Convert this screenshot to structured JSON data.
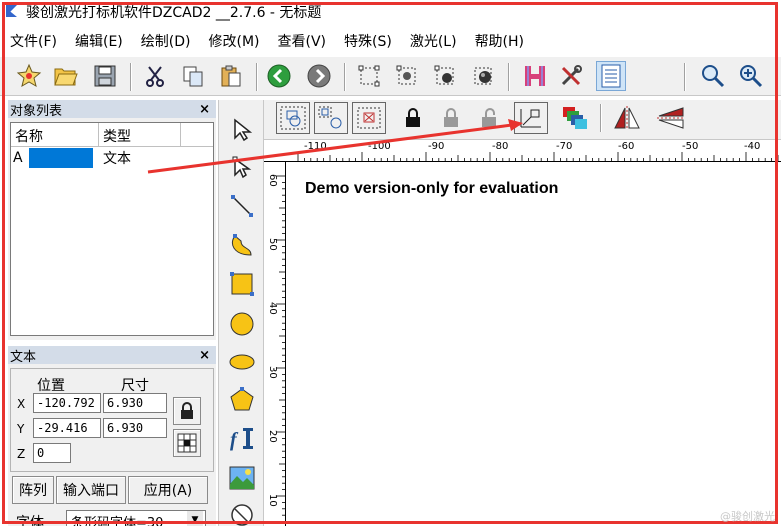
{
  "window": {
    "title": "骏创激光打标机软件DZCAD2 __2.7.6 - 无标题"
  },
  "menu": [
    {
      "id": "file",
      "label": "文件(F)"
    },
    {
      "id": "edit",
      "label": "编辑(E)"
    },
    {
      "id": "draw",
      "label": "绘制(D)"
    },
    {
      "id": "modify",
      "label": "修改(M)"
    },
    {
      "id": "view",
      "label": "查看(V)"
    },
    {
      "id": "special",
      "label": "特殊(S)"
    },
    {
      "id": "laser",
      "label": "激光(L)"
    },
    {
      "id": "help",
      "label": "帮助(H)"
    }
  ],
  "object_panel": {
    "title": "对象列表",
    "close": "×",
    "columns": [
      "名称",
      "类型"
    ],
    "rows": [
      {
        "name": "A",
        "type": "文本"
      }
    ]
  },
  "text_panel": {
    "title": "文本",
    "close": "×",
    "position_label": "位置",
    "size_label": "尺寸",
    "x_label": "X",
    "y_label": "Y",
    "z_label": "Z",
    "x_pos": "-120.792",
    "y_pos": "-29.416",
    "z_pos": "0",
    "x_size": "6.930",
    "y_size": "6.930",
    "array_button": "阵列",
    "input_port_button": "输入端口",
    "apply_button": "应用(A)",
    "font_label": "字体",
    "font_value": "条形码字体=30"
  },
  "ruler": {
    "h_labels": [
      "-110",
      "-100",
      "-90",
      "-80",
      "-70",
      "-60",
      "-50",
      "-40"
    ],
    "v_labels": [
      "60",
      "50",
      "40",
      "30",
      "20",
      "10"
    ]
  },
  "canvas": {
    "demo_text": "Demo version-only for evaluation"
  },
  "watermark": "@骏创激光",
  "colors": {
    "annotation": "#e8332e",
    "selection": "#0078d7",
    "panel_header": "#d3dce8"
  }
}
